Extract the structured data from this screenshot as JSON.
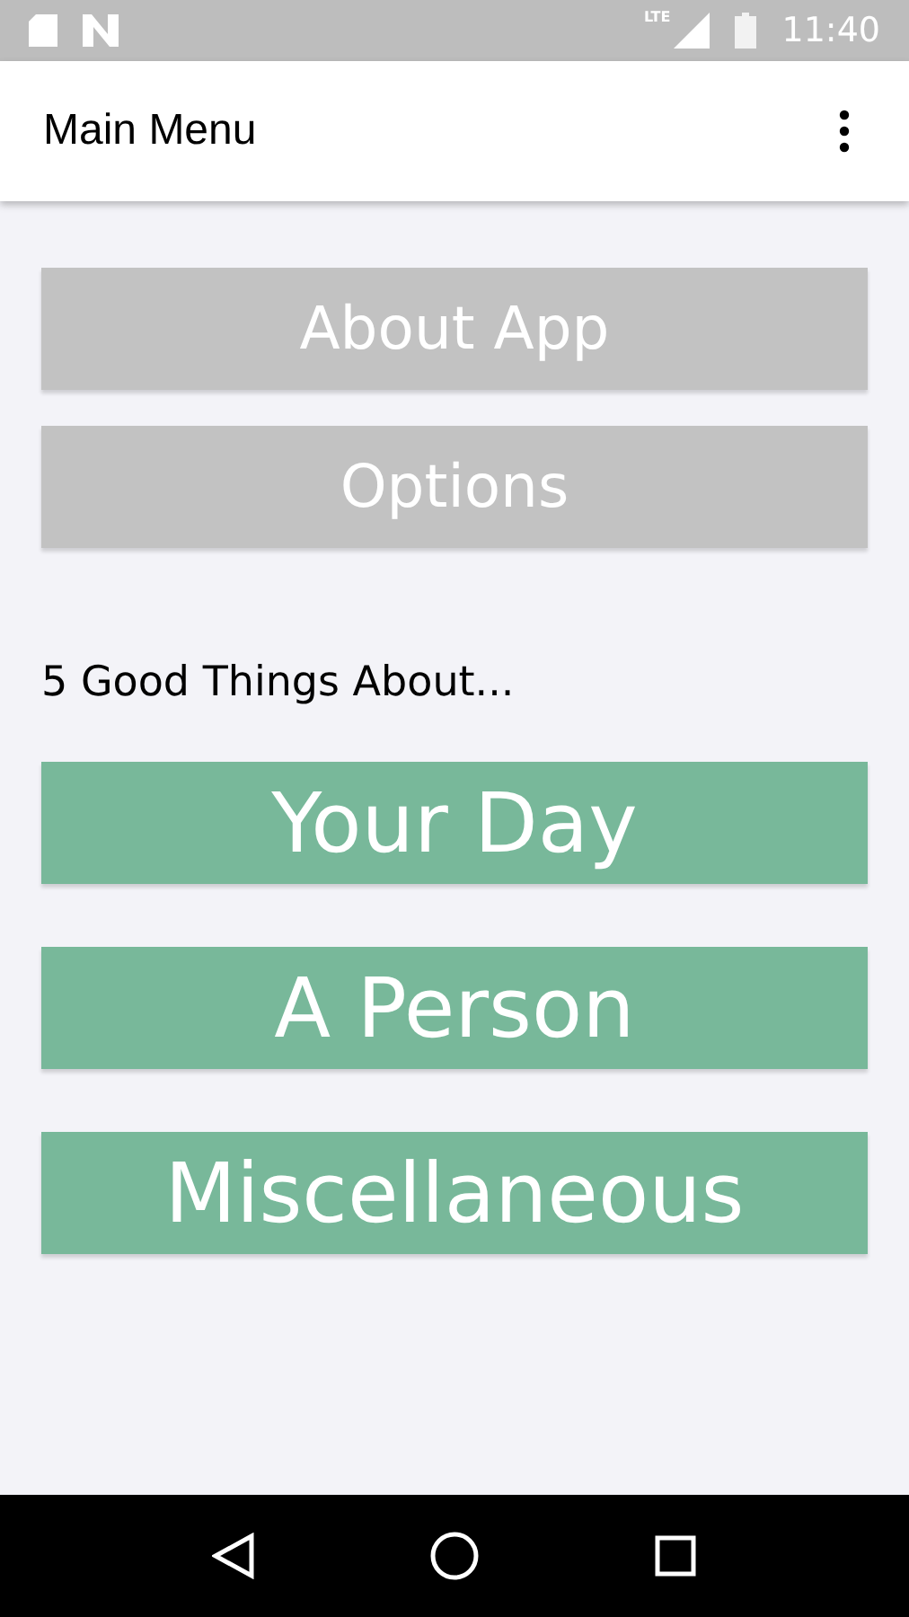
{
  "status_bar": {
    "network": "LTE",
    "time": "11:40"
  },
  "app_bar": {
    "title": "Main Menu"
  },
  "menu_buttons": [
    {
      "label": "About App"
    },
    {
      "label": "Options"
    }
  ],
  "section_label": "5 Good Things About...",
  "category_buttons": [
    {
      "label": "Your Day"
    },
    {
      "label": "A Person"
    },
    {
      "label": "Miscellaneous"
    }
  ]
}
